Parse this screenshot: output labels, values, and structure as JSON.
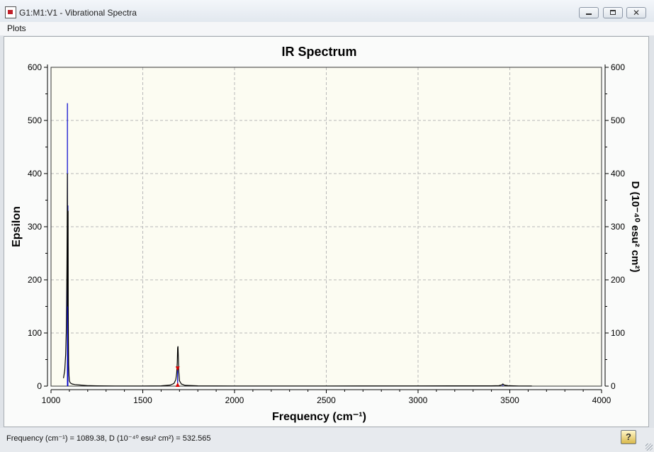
{
  "window": {
    "title": "G1:M1:V1 - Vibrational Spectra",
    "icon": "spectrum-document-icon"
  },
  "menu": {
    "plots": "Plots"
  },
  "status": {
    "text": "Frequency (cm⁻¹) = 1089.38, D (10⁻⁴⁰ esu² cm²) = 532.565",
    "help": "?"
  },
  "chart_data": {
    "type": "line",
    "title": "IR Spectrum",
    "xlabel": "Frequency (cm⁻¹)",
    "ylabel": "Epsilon",
    "y2label": "D (10⁻⁴⁰ esu² cm²)",
    "xlim": [
      1000,
      4000
    ],
    "ylim": [
      0,
      600
    ],
    "x_ticks": [
      1000,
      1500,
      2000,
      2500,
      3000,
      3500,
      4000
    ],
    "y_ticks": [
      0,
      100,
      200,
      300,
      400,
      500,
      600
    ],
    "grid": true,
    "colors": {
      "curve": "#000000",
      "sticks": "#0000cc",
      "marker": "#dd0000",
      "plot_bg": "#fcfcf2"
    },
    "series": [
      {
        "x": [
          1068,
          1075,
          1080,
          1083,
          1085,
          1087,
          1088,
          1089,
          1090,
          1091,
          1092,
          1093,
          1094,
          1095,
          1096,
          1098,
          1100,
          1105,
          1115,
          1130,
          1160,
          1200,
          1250,
          1350,
          1500,
          1600,
          1650,
          1670,
          1680,
          1685,
          1688,
          1690,
          1692,
          1694,
          1696,
          1700,
          1710,
          1730,
          1800,
          2000,
          2500,
          3000,
          3400,
          3440,
          3455,
          3462,
          3470,
          3490,
          3550,
          3620
        ],
        "y": [
          15,
          30,
          60,
          100,
          150,
          230,
          300,
          400,
          250,
          150,
          160,
          330,
          150,
          80,
          40,
          20,
          10,
          6,
          4,
          3,
          2,
          1,
          0.6,
          0.3,
          0.2,
          0.5,
          2,
          5,
          12,
          25,
          45,
          72,
          75,
          55,
          28,
          10,
          4,
          1.5,
          0.5,
          0.3,
          0.3,
          0.4,
          0.5,
          1,
          2,
          4,
          2,
          0.8,
          0.3,
          0.2
        ]
      }
    ],
    "sticks": [
      {
        "x": 1089.38,
        "d": 532.565
      },
      {
        "x": 1092,
        "d": 340
      },
      {
        "x": 1690,
        "d": 35
      },
      {
        "x": 3462,
        "d": 2
      }
    ],
    "marker": {
      "x": 1690,
      "y": 33
    }
  }
}
